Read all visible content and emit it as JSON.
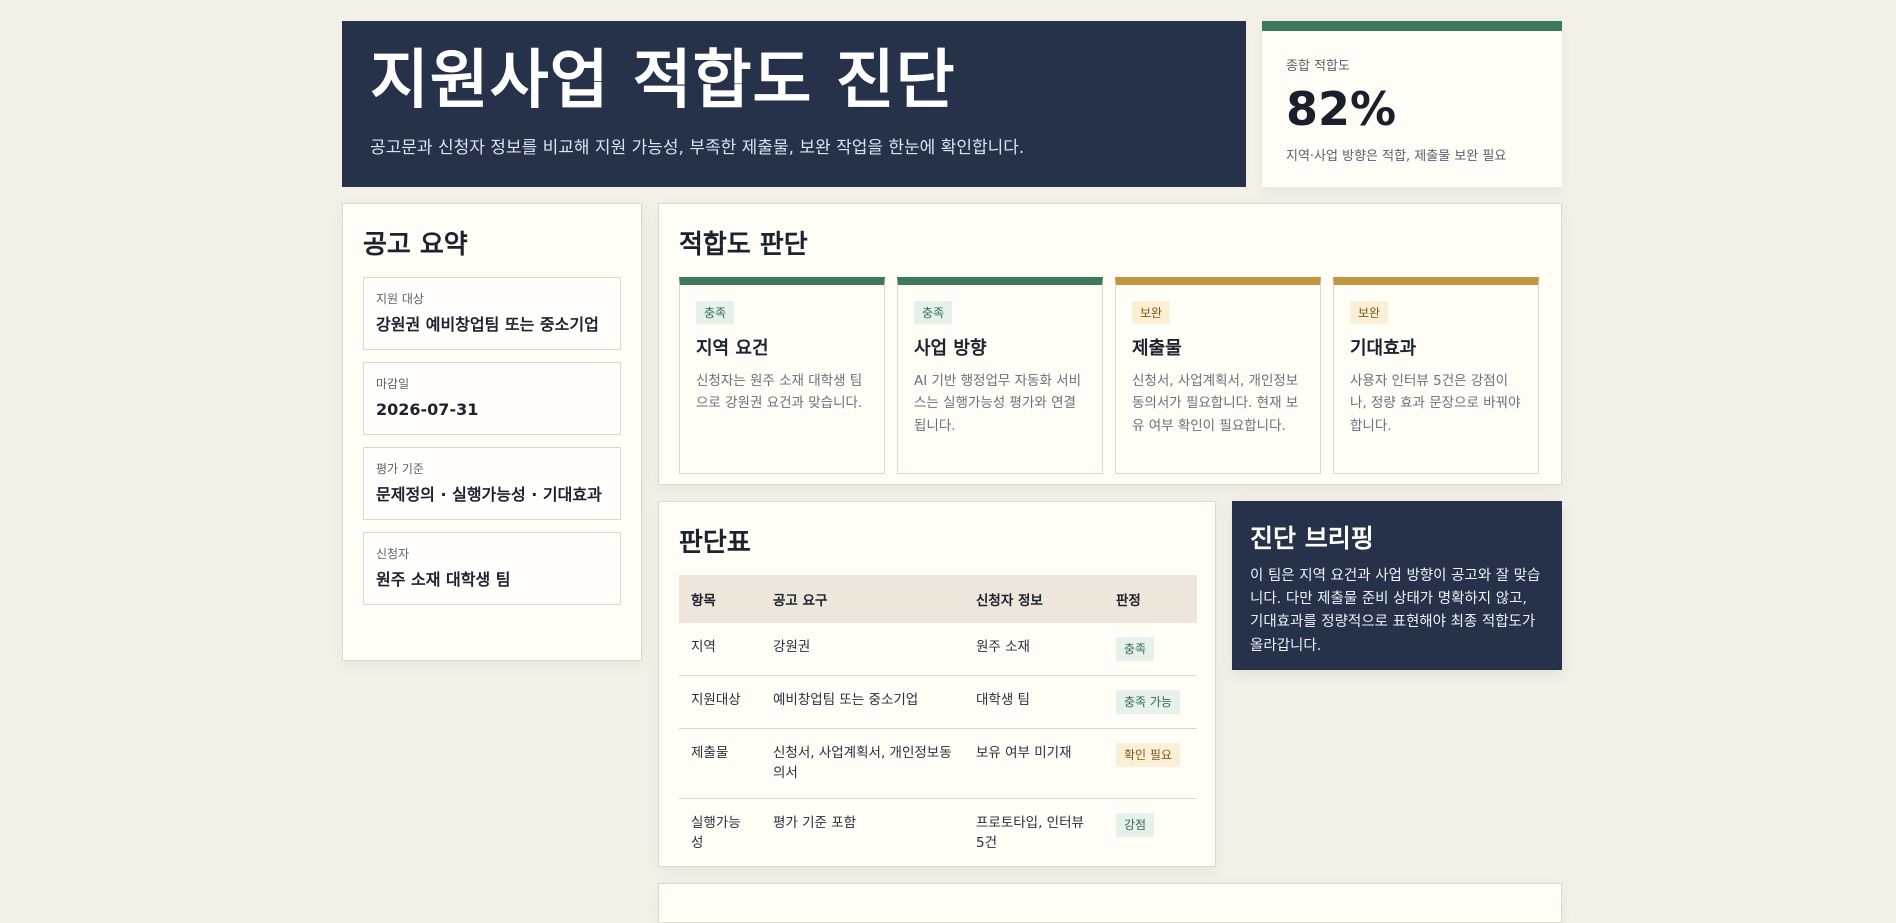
{
  "header": {
    "title": "지원사업 적합도 진단",
    "subtitle": "공고문과 신청자 정보를 비교해 지원 가능성, 부족한 제출물, 보완 작업을 한눈에 확인합니다."
  },
  "score": {
    "label": "종합 적합도",
    "value": "82%",
    "note": "지역·사업 방향은 적합, 제출물 보완 필요"
  },
  "summary": {
    "title": "공고 요약",
    "items": [
      {
        "key": "지원 대상",
        "value": "강원권 예비창업팀 또는 중소기업"
      },
      {
        "key": "마감일",
        "value": "2026-07-31"
      },
      {
        "key": "평가 기준",
        "value": "문제정의 · 실행가능성 · 기대효과"
      },
      {
        "key": "신청자",
        "value": "원주 소재 대학생 팀"
      }
    ]
  },
  "fit": {
    "title": "적합도 판단",
    "cards": [
      {
        "badge": "충족",
        "title": "지역 요건",
        "desc": "신청자는 원주 소재 대학생 팀으로 강원권 요건과 맞습니다."
      },
      {
        "badge": "충족",
        "title": "사업 방향",
        "desc": "AI 기반 행정업무 자동화 서비스는 실행가능성 평가와 연결됩니다."
      },
      {
        "badge": "보완",
        "title": "제출물",
        "desc": "신청서, 사업계획서, 개인정보동의서가 필요합니다. 현재 보유 여부 확인이 필요합니다."
      },
      {
        "badge": "보완",
        "title": "기대효과",
        "desc": "사용자 인터뷰 5건은 강점이나, 정량 효과 문장으로 바꿔야 합니다."
      }
    ]
  },
  "judge": {
    "title": "판단표",
    "headers": [
      "항목",
      "공고 요구",
      "신청자 정보",
      "판정"
    ],
    "rows": [
      {
        "item": "지역",
        "req": "강원권",
        "info": "원주 소재",
        "verdict": "충족"
      },
      {
        "item": "지원대상",
        "req": "예비창업팀 또는 중소기업",
        "info": "대학생 팀",
        "verdict": "충족 가능"
      },
      {
        "item": "제출물",
        "req": "신청서, 사업계획서, 개인정보동의서",
        "info": "보유 여부 미기재",
        "verdict": "확인 필요"
      },
      {
        "item": "실행가능성",
        "req": "평가 기준 포함",
        "info": "프로토타입, 인터뷰 5건",
        "verdict": "강점"
      }
    ]
  },
  "brief": {
    "title": "진단 브리핑",
    "text": "이 팀은 지역 요건과 사업 방향이 공고와 잘 맞습니다. 다만 제출물 준비 상태가 명확하지 않고, 기대효과를 정량적으로 표현해야 최종 적합도가 올라갑니다."
  },
  "colors": {
    "navy": "#26314a",
    "green": "#3b7a5b",
    "gold": "#c0963f",
    "background": "#f3f0e8"
  }
}
